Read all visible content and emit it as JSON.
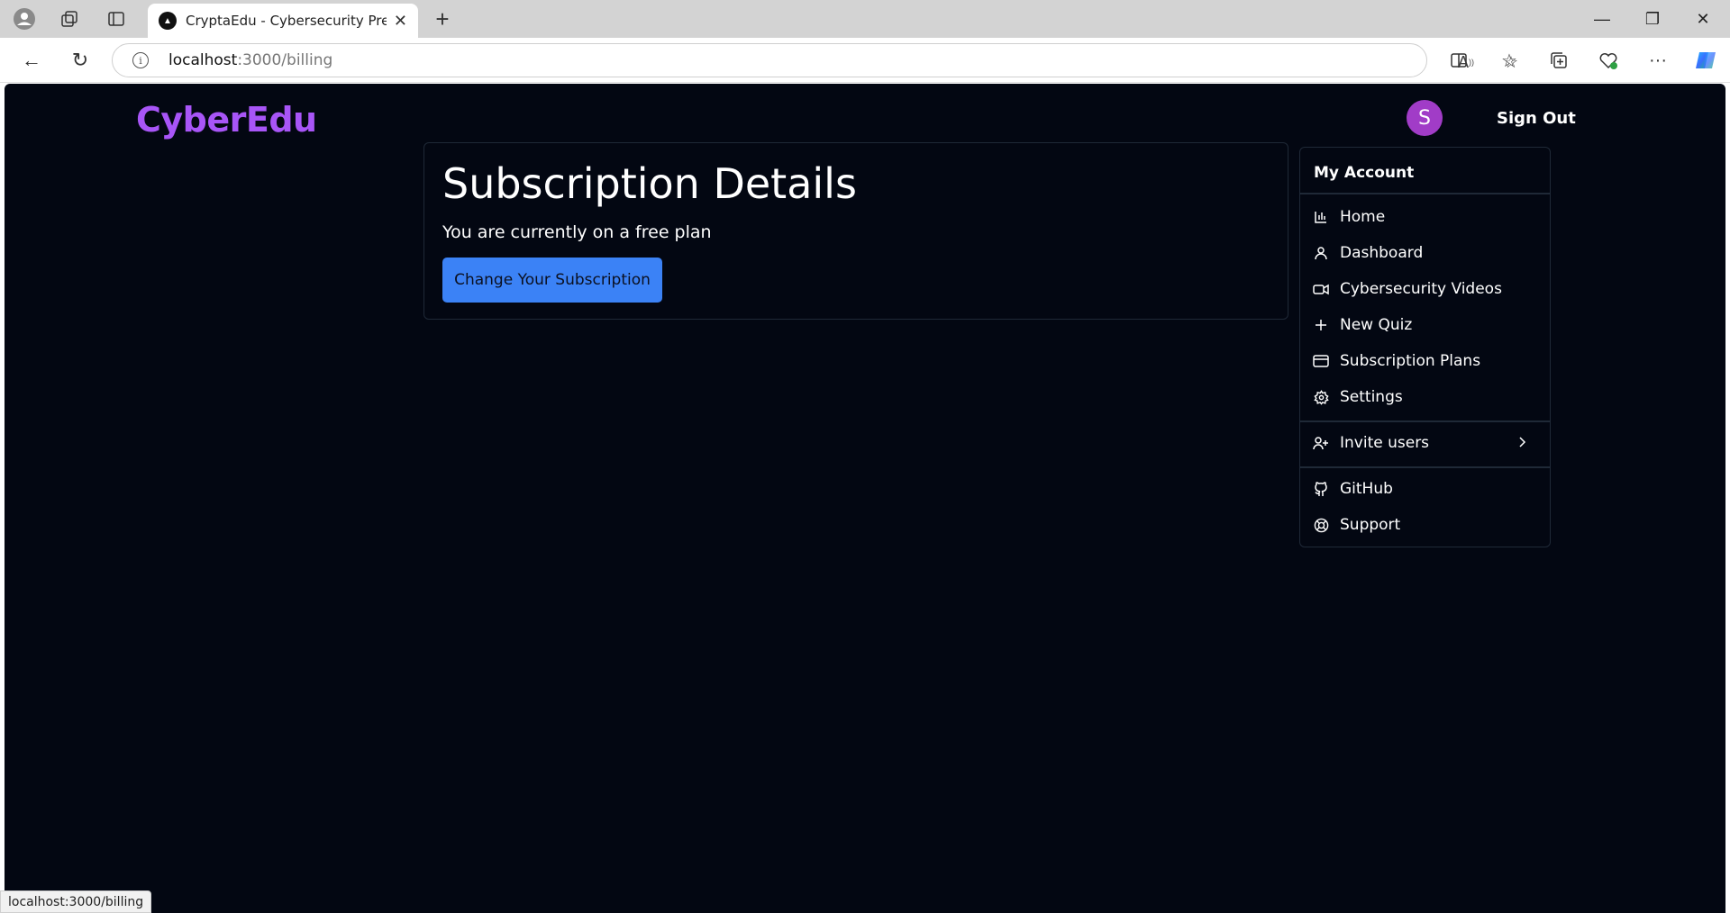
{
  "browser": {
    "tab_title": "CryptaEdu - Cybersecurity Preven",
    "url_host": "localhost",
    "url_path": ":3000/billing",
    "status_url": "localhost:3000/billing"
  },
  "header": {
    "brand": "CyberEdu",
    "avatar_initial": "S",
    "sign_out": "Sign Out"
  },
  "subscription": {
    "title": "Subscription Details",
    "description": "You are currently on a free plan",
    "button": "Change Your Subscription"
  },
  "account_menu": {
    "heading": "My Account",
    "items": [
      {
        "label": "Home",
        "icon": "bar-chart-icon"
      },
      {
        "label": "Dashboard",
        "icon": "user-icon"
      },
      {
        "label": "Cybersecurity Videos",
        "icon": "video-icon"
      },
      {
        "label": "New Quiz",
        "icon": "plus-icon"
      },
      {
        "label": "Subscription Plans",
        "icon": "credit-card-icon"
      },
      {
        "label": "Settings",
        "icon": "gear-icon"
      },
      {
        "label": "Invite users",
        "icon": "user-plus-icon"
      },
      {
        "label": "GitHub",
        "icon": "github-icon"
      },
      {
        "label": "Support",
        "icon": "life-buoy-icon"
      }
    ]
  },
  "colors": {
    "page_bg": "#030712",
    "brand": "#a855f7",
    "avatar": "#a13cc7",
    "primary_button": "#3b82f6"
  }
}
